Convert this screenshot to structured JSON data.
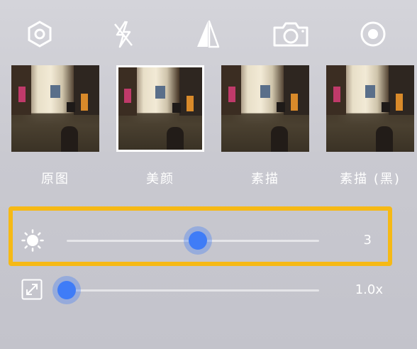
{
  "toolbar": {
    "icons": [
      "settings-hexagon-icon",
      "flash-off-icon",
      "aperture-icon",
      "camera-icon",
      "record-icon"
    ]
  },
  "filters": [
    {
      "label": "原图",
      "selected": false
    },
    {
      "label": "美颜",
      "selected": true
    },
    {
      "label": "素描",
      "selected": false
    },
    {
      "label": "素描 (黑)",
      "selected": false
    }
  ],
  "brightness": {
    "icon": "brightness-sun-icon",
    "value": "3",
    "level": 0.52
  },
  "zoom": {
    "icon": "expand-arrows-icon",
    "value": "1.0x",
    "level": 0.0
  },
  "colors": {
    "accent": "#3f7cf7",
    "highlight": "#f6b915"
  }
}
